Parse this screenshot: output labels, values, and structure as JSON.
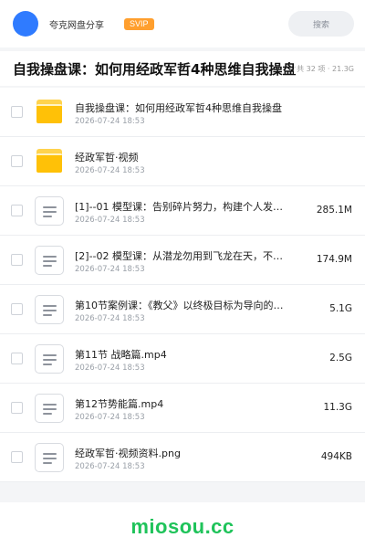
{
  "header": {
    "user_name": "夸克网盘分享",
    "badge": "SVIP",
    "search_label": "搜索"
  },
  "share": {
    "title": "自我操盘课：如何用经政军哲4种思维自我操盘",
    "meta": "共 32 项 · 21.3G"
  },
  "files": [
    {
      "type": "folder",
      "name": "自我操盘课：如何用经政军哲4种思维自我操盘",
      "date": "2026-07-24 18:53",
      "size": ""
    },
    {
      "type": "folder",
      "name": "经政军哲·视频",
      "date": "2026-07-24 18:53",
      "size": ""
    },
    {
      "type": "file",
      "name": "[1]--01 模型课：告别碎片努力，构建个人发展…",
      "date": "2026-07-24 18:53",
      "size": "285.1M"
    },
    {
      "type": "file",
      "name": "[2]--02 模型课：从潜龙勿用到飞龙在天，不同…",
      "date": "2026-07-24 18:53",
      "size": "174.9M"
    },
    {
      "type": "file",
      "name": "第10节案例课：《教父》以终极目标为导向的绝对理性…",
      "date": "2026-07-24 18:53",
      "size": "5.1G"
    },
    {
      "type": "file",
      "name": "第11节 战略篇.mp4",
      "date": "2026-07-24 18:53",
      "size": "2.5G"
    },
    {
      "type": "file",
      "name": "第12节势能篇.mp4",
      "date": "2026-07-24 18:53",
      "size": "11.3G"
    },
    {
      "type": "file",
      "name": "经政军哲·视频资料.png",
      "date": "2026-07-24 18:53",
      "size": "494KB"
    }
  ],
  "watermark": "miosou.cc",
  "colors": {
    "accent": "#2f7bff",
    "svip": "#ff9f2e",
    "folder": "#ffc107",
    "watermark": "#1fc35a"
  }
}
